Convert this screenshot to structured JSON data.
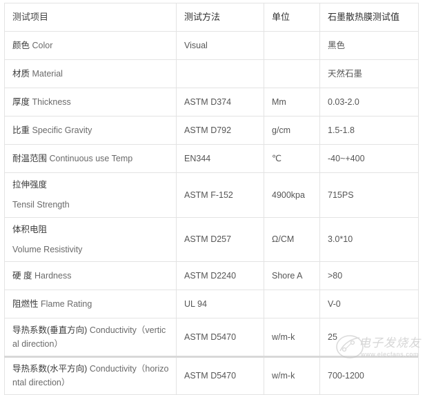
{
  "table": {
    "headers": [
      "测试项目",
      "测试方法",
      "单位",
      "石墨散热膜测试值"
    ],
    "rows": [
      {
        "item_cn": "颜色",
        "item_en": "Color",
        "method": "Visual",
        "unit": "",
        "value": "黑色",
        "layout": "inline"
      },
      {
        "item_cn": "材质",
        "item_en": "Material",
        "method": "",
        "unit": "",
        "value": "天然石墨",
        "layout": "inline"
      },
      {
        "item_cn": "厚度",
        "item_en": "Thickness",
        "method": "ASTM D374",
        "unit": "Mm",
        "value": "0.03-2.0",
        "layout": "inline"
      },
      {
        "item_cn": "比重",
        "item_en": "Specific Gravity",
        "method": "ASTM D792",
        "unit": "g/cm",
        "value": "1.5-1.8",
        "layout": "inline"
      },
      {
        "item_cn": "耐温范围",
        "item_en": "Continuous use Temp",
        "method": "EN344",
        "unit": "℃",
        "value": "-40~+400",
        "layout": "inline"
      },
      {
        "item_cn": "拉伸强度",
        "item_en": "Tensil Strength",
        "method": "ASTM F-152",
        "unit": "4900kpa",
        "value": "715PS",
        "layout": "stacked"
      },
      {
        "item_cn": "体积电阻",
        "item_en": "Volume Resistivity",
        "method": "ASTM D257",
        "unit": "Ω/CM",
        "value": "3.0*10",
        "layout": "stacked"
      },
      {
        "item_cn": "硬 度",
        "item_en": "Hardness",
        "method": "ASTM D2240",
        "unit": "Shore A",
        "value": ">80",
        "layout": "tight"
      },
      {
        "item_cn": "阻燃性",
        "item_en": "Flame Rating",
        "method": "UL 94",
        "unit": "",
        "value": "V-0",
        "layout": "tight"
      },
      {
        "item_cn": "导热系数(垂直方向)",
        "item_en": "Conductivity（vertical direction）",
        "method": "ASTM D5470",
        "unit": "w/m-k",
        "value": "25",
        "layout": "wrap"
      },
      {
        "item_cn": "导热系数(水平方向)",
        "item_en": "Conductivity（horizontal direction）",
        "method": "ASTM D5470",
        "unit": "w/m-k",
        "value": "700-1200",
        "layout": "wrap"
      }
    ]
  },
  "watermark": {
    "brand_cn": "电子发烧友",
    "site": "www.elecfans.com"
  },
  "colors": {
    "border": "#e3e3e3",
    "text": "#555555",
    "heading": "#2f2f2f",
    "watermark": "#bdbdbd",
    "bottom_rule": "#d8d8d8"
  }
}
